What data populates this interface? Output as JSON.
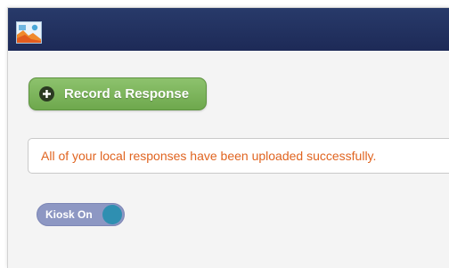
{
  "header": {
    "logo_icon": "app-logo-icon",
    "background_color": "#1d2a57"
  },
  "main": {
    "record_button": {
      "label": "Record a Response",
      "icon": "plus-circle-icon",
      "color": "#76ad55"
    },
    "alert": {
      "message": "All of your local responses have been uploaded successfully.",
      "text_color": "#e06420"
    },
    "kiosk_toggle": {
      "label": "Kiosk On",
      "state": "on",
      "track_color": "#8d97c3",
      "knob_color": "#2f8fb1"
    }
  }
}
